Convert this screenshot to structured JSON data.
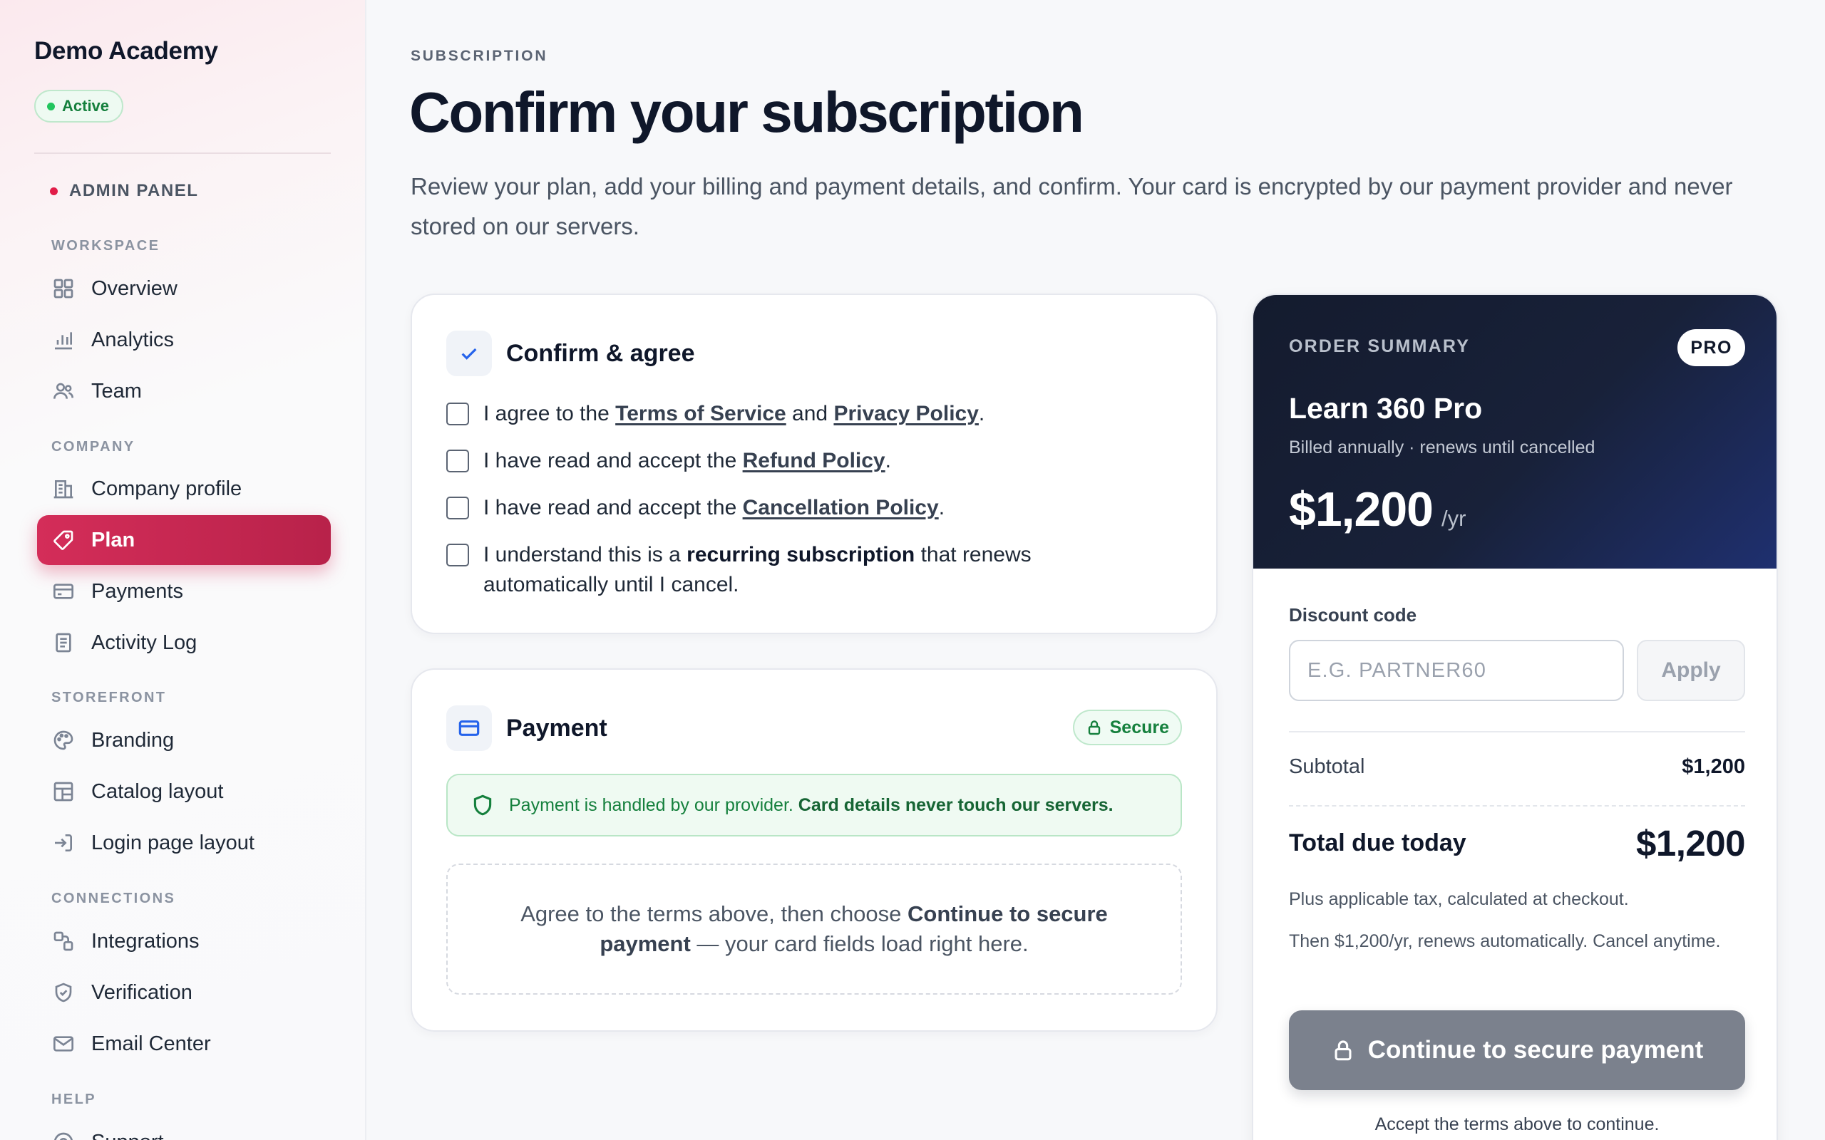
{
  "sidebar": {
    "brand": "Demo Academy",
    "status": "Active",
    "panel_label": "ADMIN PANEL",
    "sections": {
      "workspace": "WORKSPACE",
      "company": "COMPANY",
      "storefront": "STOREFRONT",
      "connections": "CONNECTIONS",
      "help": "HELP"
    },
    "items": {
      "overview": "Overview",
      "analytics": "Analytics",
      "team": "Team",
      "company_profile": "Company profile",
      "plan": "Plan",
      "payments": "Payments",
      "activity_log": "Activity Log",
      "branding": "Branding",
      "catalog_layout": "Catalog layout",
      "login_page_layout": "Login page layout",
      "integrations": "Integrations",
      "verification": "Verification",
      "email_center": "Email Center",
      "support": "Support"
    },
    "active_item": "Plan"
  },
  "header": {
    "eyebrow": "SUBSCRIPTION",
    "title": "Confirm your subscription",
    "description": "Review your plan, add your billing and payment details, and confirm. Your card is encrypted by our payment provider and never stored on our servers."
  },
  "confirm": {
    "title": "Confirm & agree",
    "terms": {
      "prefix": "I agree to the ",
      "terms_link": "Terms of Service",
      "and": " and ",
      "privacy_link": "Privacy Policy",
      "suffix": "."
    },
    "refund": {
      "prefix": "I have read and accept the ",
      "link": "Refund Policy",
      "suffix": "."
    },
    "cancellation": {
      "prefix": "I have read and accept the ",
      "link": "Cancellation Policy",
      "suffix": "."
    },
    "recurring": {
      "prefix": "I understand this is a ",
      "strong": "recurring subscription",
      "suffix": " that renews automatically until I cancel."
    }
  },
  "payment": {
    "title": "Payment",
    "secure_badge": "Secure",
    "provider_note": "Payment is handled by our provider. ",
    "provider_note_strong": "Card details never touch our servers.",
    "placeholder_prefix": "Agree to the terms above, then choose ",
    "placeholder_strong": "Continue to secure payment",
    "placeholder_suffix": " — your card fields load right here."
  },
  "summary": {
    "eyebrow": "ORDER SUMMARY",
    "badge": "PRO",
    "plan_name": "Learn 360 Pro",
    "billing": "Billed annually · renews until cancelled",
    "price": "$1,200",
    "period": "/yr",
    "discount_label": "Discount code",
    "discount_placeholder": "E.G. PARTNER60",
    "discount_value": "",
    "apply_label": "Apply",
    "subtotal_label": "Subtotal",
    "subtotal_value": "$1,200",
    "total_label": "Total due today",
    "total_value": "$1,200",
    "tax_note": "Plus applicable tax, calculated at checkout.",
    "renewal_note": "Then $1,200/yr, renews automatically. Cancel anytime.",
    "cta_label": "Continue to secure payment",
    "cta_hint": "Accept the terms above to continue."
  },
  "colors": {
    "accent": "#c8264f",
    "success": "#15803d",
    "summary_dark": "#141b2e",
    "cta_disabled": "#7b818d"
  },
  "icons": {
    "overview": "grid-icon",
    "analytics": "bar-chart-icon",
    "team": "users-icon",
    "company_profile": "building-icon",
    "plan": "tag-icon",
    "payments": "credit-card-icon",
    "activity_log": "document-icon",
    "branding": "palette-icon",
    "catalog_layout": "layout-icon",
    "login_page_layout": "login-icon",
    "integrations": "puzzle-icon",
    "verification": "shield-check-icon",
    "email_center": "mail-icon",
    "support": "life-buoy-icon"
  }
}
